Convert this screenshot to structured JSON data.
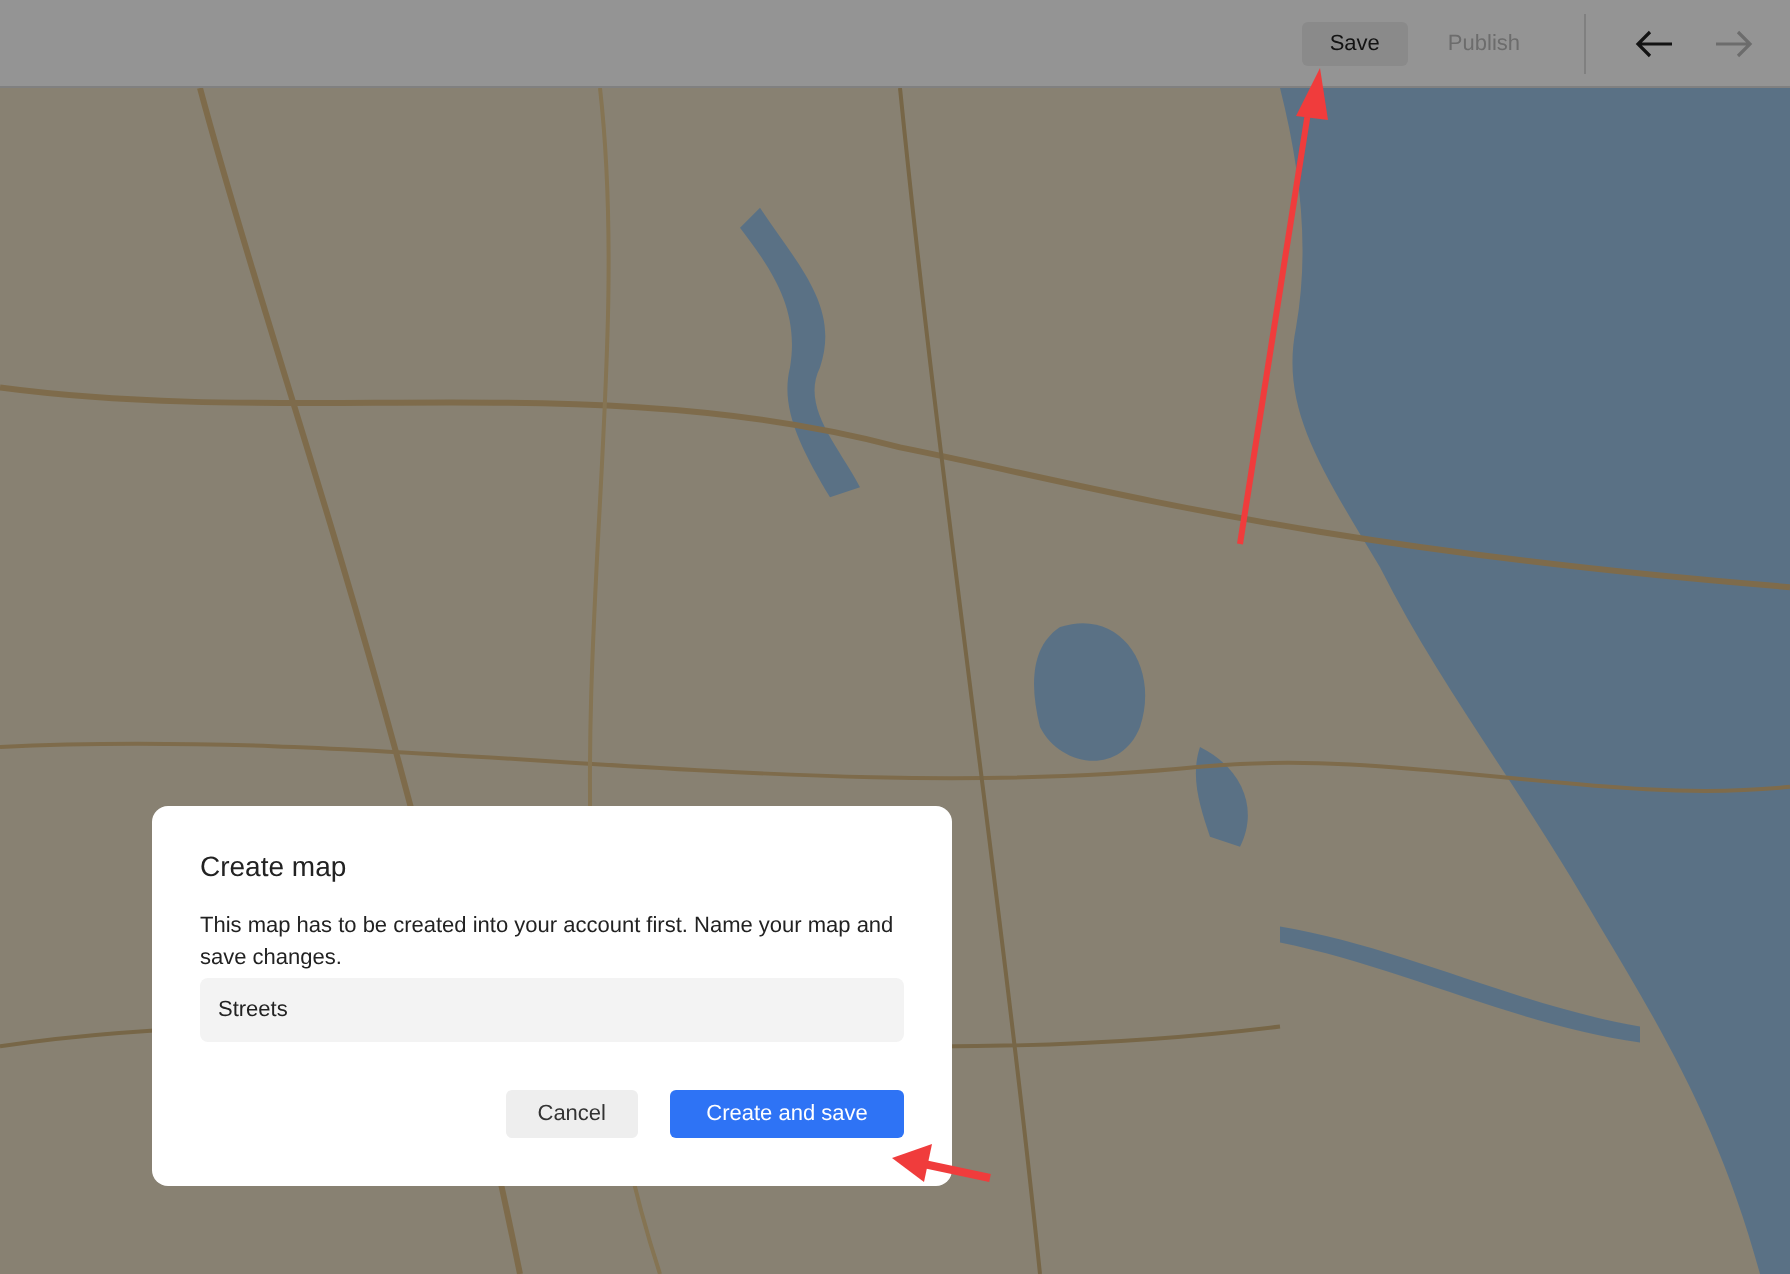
{
  "toolbar": {
    "actions": [
      {
        "label": "Save",
        "disabled": false,
        "kind": "secondary"
      },
      {
        "label": "Publish",
        "disabled": true,
        "kind": "text"
      }
    ],
    "nav": [
      {
        "kind": "back",
        "disabled": false
      },
      {
        "kind": "forward",
        "disabled": true
      }
    ]
  },
  "dialog": {
    "title": "Create map",
    "message": "This map has to be created into your account first. Name your map and save changes.",
    "name_field": {
      "value": "Streets"
    },
    "buttons": [
      {
        "label": "Cancel",
        "kind": "secondary"
      },
      {
        "label": "Create and save",
        "kind": "primary"
      }
    ]
  }
}
